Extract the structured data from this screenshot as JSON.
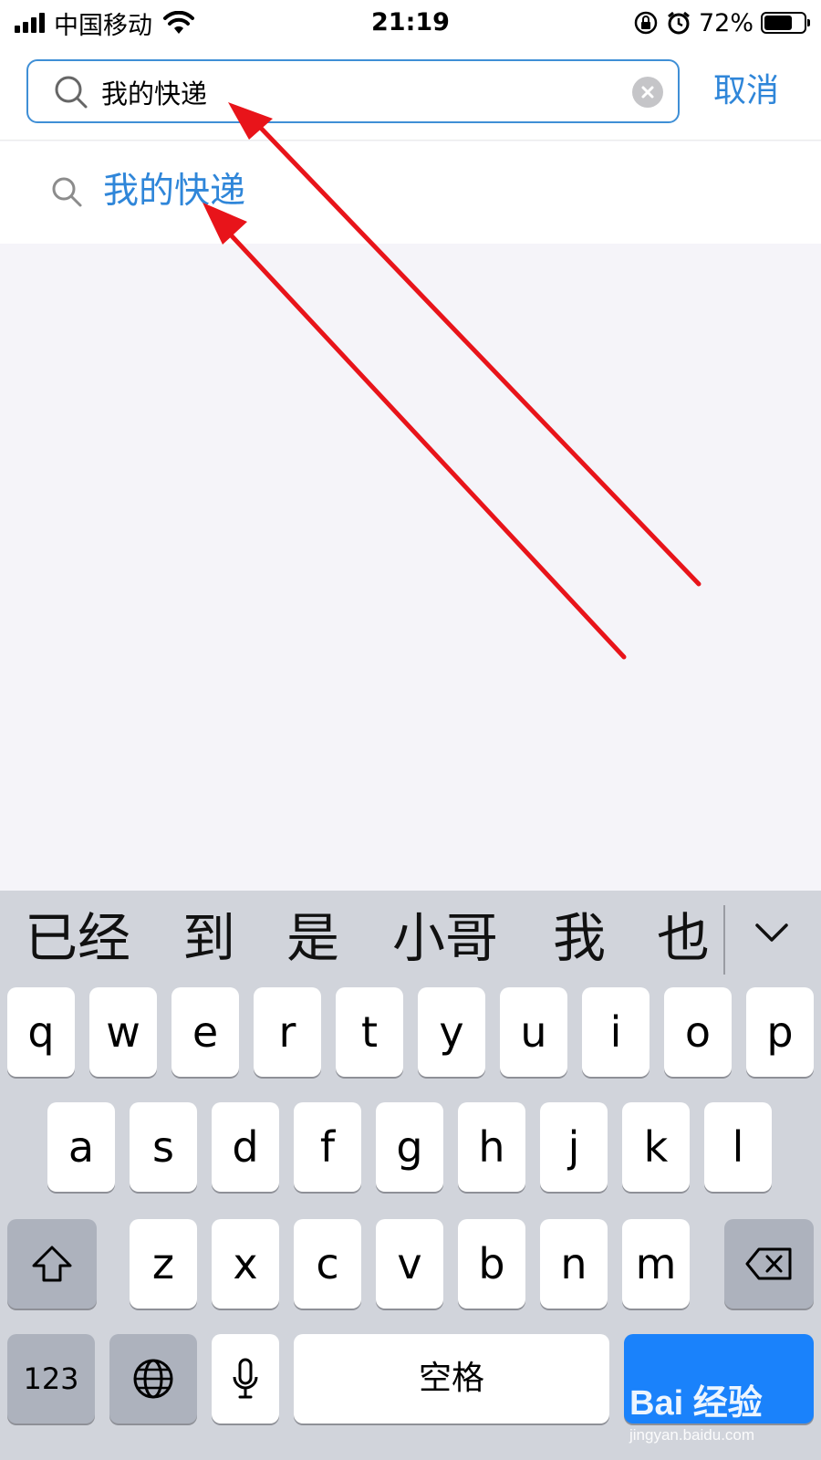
{
  "status_bar": {
    "carrier": "中国移动",
    "time": "21:19",
    "battery_percent": "72%",
    "battery_level": 0.72,
    "icons": [
      "signal-icon",
      "wifi-icon",
      "rotation-lock-icon",
      "alarm-icon",
      "battery-icon"
    ]
  },
  "search": {
    "query": "我的快递",
    "cancel_label": "取消",
    "accent_color": "#2f86d9"
  },
  "suggestions": [
    {
      "text": "我的快递"
    }
  ],
  "keyboard": {
    "candidates": [
      "已经",
      "到",
      "是",
      "小哥",
      "我",
      "也"
    ],
    "row1": [
      "q",
      "w",
      "e",
      "r",
      "t",
      "y",
      "u",
      "i",
      "o",
      "p"
    ],
    "row2": [
      "a",
      "s",
      "d",
      "f",
      "g",
      "h",
      "j",
      "k",
      "l"
    ],
    "row3": [
      "z",
      "x",
      "c",
      "v",
      "b",
      "n",
      "m"
    ],
    "numbers_label": "123",
    "space_label": "空格",
    "return_color": "#1a82fb"
  },
  "watermark": {
    "brand": "Bai 经验",
    "url": "jingyan.baidu.com"
  }
}
